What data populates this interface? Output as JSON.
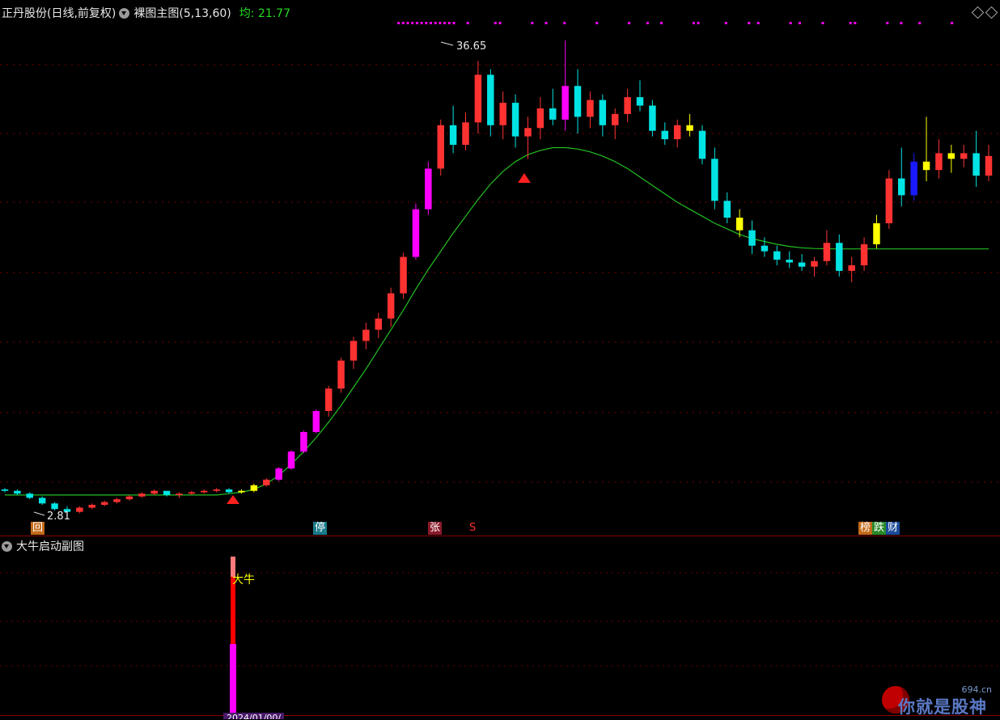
{
  "main_header": {
    "stock_title": "正丹股份(日线,前复权)",
    "indicator_name": "裸图主图(5,13,60)",
    "ma_label": "均: 21.77"
  },
  "sub_header": {
    "indicator_name": "大牛启动副图"
  },
  "annotations": {
    "high_price": "36.65",
    "low_price": "2.81",
    "big_bull_label": "大牛"
  },
  "event_tags": {
    "back": "回",
    "halt": "停",
    "limit_up": "张",
    "s_mark": "S",
    "list": "榜",
    "fall": "跌",
    "finance": "财"
  },
  "bottom_axis": {
    "date_label": "2024/01/00/"
  },
  "watermark": {
    "site": "694.cn",
    "text": "你就是股神"
  },
  "colors": {
    "background": "#000000",
    "up_candle": "#ff3232",
    "down_candle": "#00e4e4",
    "ma_line": "#22c022",
    "signal_magenta": "#ff00ff",
    "signal_yellow": "#ffff00",
    "signal_blue": "#1a1aff",
    "grid": "#7a0000"
  },
  "chart_data": {
    "type": "candlestick",
    "price_extremes": {
      "high": 36.65,
      "low": 2.81
    },
    "ma_value": 21.77,
    "candles_ohlc": [
      [
        4.6,
        4.7,
        4.4,
        4.5
      ],
      [
        4.5,
        4.6,
        4.2,
        4.3
      ],
      [
        4.3,
        4.4,
        3.9,
        4.0
      ],
      [
        4.0,
        4.1,
        3.5,
        3.6
      ],
      [
        3.6,
        3.7,
        3.1,
        3.2
      ],
      [
        3.2,
        3.4,
        2.81,
        3.0
      ],
      [
        3.0,
        3.4,
        2.9,
        3.3
      ],
      [
        3.3,
        3.6,
        3.2,
        3.5
      ],
      [
        3.5,
        3.8,
        3.4,
        3.7
      ],
      [
        3.7,
        4.0,
        3.6,
        3.9
      ],
      [
        3.9,
        4.2,
        3.8,
        4.1
      ],
      [
        4.1,
        4.4,
        4.0,
        4.3
      ],
      [
        4.3,
        4.6,
        4.2,
        4.5
      ],
      [
        4.5,
        4.5,
        4.1,
        4.2
      ],
      [
        4.2,
        4.4,
        4.0,
        4.3
      ],
      [
        4.3,
        4.5,
        4.2,
        4.4
      ],
      [
        4.4,
        4.6,
        4.3,
        4.5
      ],
      [
        4.5,
        4.7,
        4.4,
        4.6
      ],
      [
        4.6,
        4.7,
        4.3,
        4.4
      ],
      [
        4.4,
        4.6,
        4.3,
        4.5
      ],
      [
        4.5,
        5.0,
        4.4,
        4.9
      ],
      [
        4.9,
        5.4,
        4.8,
        5.3
      ],
      [
        5.3,
        6.2,
        5.2,
        6.1
      ],
      [
        6.1,
        7.4,
        6.0,
        7.3
      ],
      [
        7.3,
        8.8,
        7.2,
        8.7
      ],
      [
        8.7,
        10.3,
        8.6,
        10.2
      ],
      [
        10.2,
        12.0,
        9.8,
        11.8
      ],
      [
        11.8,
        14.0,
        11.5,
        13.8
      ],
      [
        13.8,
        15.5,
        13.2,
        15.2
      ],
      [
        15.2,
        16.5,
        14.6,
        16.0
      ],
      [
        16.0,
        17.2,
        15.4,
        16.8
      ],
      [
        16.8,
        19.0,
        16.2,
        18.6
      ],
      [
        18.6,
        21.5,
        18.2,
        21.2
      ],
      [
        21.2,
        25.0,
        21.0,
        24.6
      ],
      [
        24.6,
        28.0,
        24.2,
        27.5
      ],
      [
        27.5,
        31.0,
        27.0,
        30.6
      ],
      [
        30.6,
        32.0,
        28.6,
        29.2
      ],
      [
        29.2,
        31.5,
        28.8,
        30.8
      ],
      [
        30.8,
        35.2,
        30.0,
        34.2
      ],
      [
        34.2,
        34.6,
        29.8,
        30.6
      ],
      [
        30.6,
        33.0,
        29.6,
        32.2
      ],
      [
        32.2,
        32.8,
        29.0,
        29.8
      ],
      [
        29.8,
        31.2,
        28.2,
        30.4
      ],
      [
        30.4,
        32.6,
        29.6,
        31.8
      ],
      [
        31.8,
        33.2,
        30.6,
        31.0
      ],
      [
        31.0,
        36.65,
        30.2,
        33.4
      ],
      [
        33.4,
        34.6,
        30.0,
        31.2
      ],
      [
        31.2,
        33.0,
        30.4,
        32.4
      ],
      [
        32.4,
        32.8,
        29.8,
        30.6
      ],
      [
        30.6,
        31.8,
        29.6,
        31.4
      ],
      [
        31.4,
        33.2,
        30.8,
        32.6
      ],
      [
        32.6,
        33.8,
        31.6,
        32.0
      ],
      [
        32.0,
        32.4,
        29.8,
        30.2
      ],
      [
        30.2,
        30.8,
        29.2,
        29.6
      ],
      [
        29.6,
        31.0,
        29.0,
        30.6
      ],
      [
        30.6,
        31.4,
        29.8,
        30.2
      ],
      [
        30.2,
        30.6,
        27.8,
        28.2
      ],
      [
        28.2,
        29.0,
        24.6,
        25.2
      ],
      [
        25.2,
        25.8,
        23.6,
        24.0
      ],
      [
        24.0,
        24.6,
        22.6,
        23.1
      ],
      [
        23.1,
        23.8,
        21.4,
        22.0
      ],
      [
        22.0,
        22.6,
        21.2,
        21.6
      ],
      [
        21.6,
        22.0,
        20.6,
        21.0
      ],
      [
        21.0,
        21.6,
        20.4,
        20.8
      ],
      [
        20.8,
        21.4,
        20.2,
        20.5
      ],
      [
        20.5,
        21.2,
        19.8,
        20.9
      ],
      [
        20.9,
        23.1,
        20.6,
        22.2
      ],
      [
        22.2,
        22.8,
        19.8,
        20.2
      ],
      [
        20.2,
        21.2,
        19.4,
        20.6
      ],
      [
        20.6,
        22.6,
        20.2,
        22.1
      ],
      [
        22.1,
        24.2,
        21.8,
        23.6
      ],
      [
        23.6,
        27.4,
        23.2,
        26.8
      ],
      [
        26.8,
        29.0,
        24.8,
        25.6
      ],
      [
        25.6,
        28.6,
        25.2,
        28.0
      ],
      [
        28.0,
        31.2,
        26.6,
        27.4
      ],
      [
        27.4,
        29.6,
        26.8,
        28.6
      ],
      [
        28.6,
        29.2,
        27.2,
        28.2
      ],
      [
        28.2,
        29.2,
        27.6,
        28.6
      ],
      [
        28.6,
        30.2,
        26.2,
        27.0
      ],
      [
        27.0,
        29.2,
        26.6,
        28.4
      ]
    ],
    "ma_series": [
      4.2,
      4.2,
      4.2,
      4.2,
      4.2,
      4.2,
      4.2,
      4.2,
      4.2,
      4.2,
      4.2,
      4.2,
      4.2,
      4.2,
      4.2,
      4.2,
      4.2,
      4.2,
      4.3,
      4.4,
      4.6,
      5.0,
      5.6,
      6.4,
      7.3,
      8.3,
      9.4,
      10.6,
      11.9,
      13.2,
      14.6,
      16.0,
      17.4,
      18.9,
      20.3,
      21.6,
      22.9,
      24.1,
      25.3,
      26.4,
      27.3,
      28.0,
      28.5,
      28.8,
      29.0,
      29.0,
      28.9,
      28.7,
      28.4,
      28.0,
      27.5,
      26.9,
      26.3,
      25.7,
      25.1,
      24.6,
      24.1,
      23.6,
      23.2,
      22.8,
      22.5,
      22.3,
      22.1,
      21.95,
      21.85,
      21.8,
      21.78,
      21.77,
      21.77,
      21.77,
      21.77,
      21.77,
      21.77,
      21.77,
      21.77,
      21.77,
      21.77,
      21.77,
      21.77,
      21.77
    ],
    "signals": [
      {
        "index": 19,
        "label": "大牛"
      }
    ]
  }
}
